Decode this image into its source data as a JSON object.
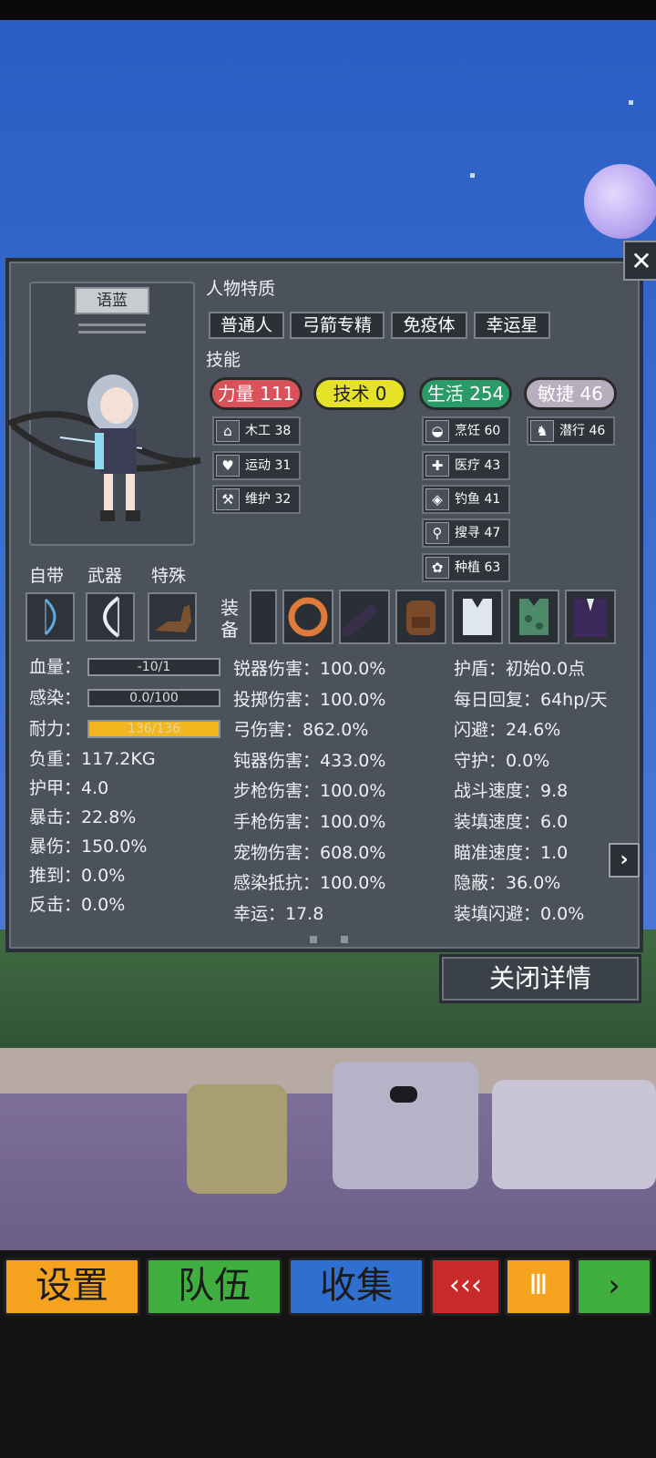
{
  "character": {
    "name": "语蓝"
  },
  "traits": {
    "title": "人物特质",
    "items": [
      "普通人",
      "弓箭专精",
      "免疫体",
      "幸运星"
    ]
  },
  "skills": {
    "title": "技能",
    "categories": [
      {
        "label": "力量 111",
        "color": "#d9525a"
      },
      {
        "label": "技术 0",
        "color": "#e6e22a"
      },
      {
        "label": "生活 254",
        "color": "#2a9a66"
      },
      {
        "label": "敏捷 46",
        "color": "#b7aebf"
      }
    ],
    "strength": [
      {
        "label": "木工 38",
        "icon": "house-icon"
      },
      {
        "label": "运动 31",
        "icon": "heart-icon"
      },
      {
        "label": "维护 32",
        "icon": "wrench-icon"
      }
    ],
    "life": [
      {
        "label": "烹饪 60",
        "icon": "pot-icon"
      },
      {
        "label": "医疗 43",
        "icon": "medkit-icon"
      },
      {
        "label": "钓鱼 41",
        "icon": "fish-icon"
      },
      {
        "label": "搜寻 47",
        "icon": "magnifier-icon"
      },
      {
        "label": "种植 63",
        "icon": "flower-icon"
      }
    ],
    "agility": [
      {
        "label": "潜行 46",
        "icon": "stealth-icon"
      }
    ]
  },
  "slots": {
    "builtin_label": "自带",
    "weapon_label": "武器",
    "special_label": "特殊",
    "equipment_label": "装备"
  },
  "equipment": [
    {
      "icon": "empty-slot"
    },
    {
      "icon": "ring-icon",
      "color": "#e07a3a"
    },
    {
      "icon": "flashlight-icon",
      "color": "#3a2f4a"
    },
    {
      "icon": "backpack-icon",
      "color": "#7a4a2a"
    },
    {
      "icon": "vest-icon",
      "color": "#dfe6ee"
    },
    {
      "icon": "camo-vest-icon",
      "color": "#4e8a6a"
    },
    {
      "icon": "suit-icon",
      "color": "#3d2a5a"
    }
  ],
  "bars": {
    "hp_label": "血量：",
    "hp_text": "-10/1",
    "infection_label": "感染：",
    "infection_text": "0.0/100",
    "stamina_label": "耐力：",
    "stamina_text": "136/136",
    "stamina_fraction": 1.0
  },
  "stats_left": [
    "负重：117.2KG",
    "护甲：4.0",
    "暴击：22.8%",
    "暴伤：150.0%",
    "推到：0.0%",
    "反击：0.0%"
  ],
  "stats_middle": [
    "锐器伤害：100.0%",
    "投掷伤害：100.0%",
    "弓伤害：862.0%",
    "钝器伤害：433.0%",
    "步枪伤害：100.0%",
    "手枪伤害：100.0%",
    "宠物伤害：608.0%",
    "感染抵抗：100.0%",
    "幸运：17.8"
  ],
  "stats_right": [
    "护盾：初始0.0点",
    "每日回复：64hp/天",
    "闪避：24.6%",
    "守护：0.0%",
    "战斗速度：9.8",
    "装填速度：6.0",
    "瞄准速度：1.0",
    "隐蔽：36.0%",
    "装填闪避：0.0%"
  ],
  "close_details_label": "关闭详情",
  "close_glyph": "✕",
  "next_glyph": "›",
  "nav": [
    {
      "label": "设置",
      "color": "#f5a21f"
    },
    {
      "label": "队伍",
      "color": "#3fb03f"
    },
    {
      "label": "收集",
      "color": "#2f6fd0"
    },
    {
      "label": "‹‹‹",
      "color": "#c92a2a"
    },
    {
      "label": "Ⅲ",
      "color": "#f5a21f"
    },
    {
      "label": "›",
      "color": "#3fb03f"
    }
  ]
}
